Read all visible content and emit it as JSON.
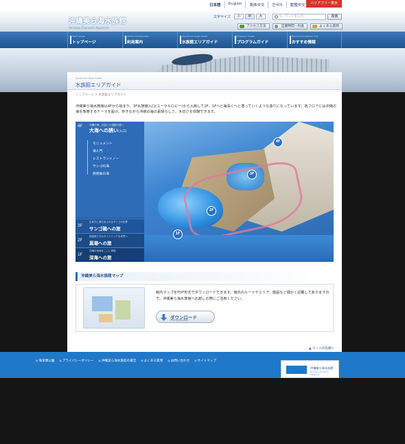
{
  "header": {
    "logo_jp": "沖縄美ら海水族館",
    "logo_en": "Okinawa Churaumi Aquarium",
    "languages": [
      "日本語",
      "English",
      "简体中文",
      "한국어",
      "繁體中文"
    ],
    "barrier_free": "バリアフリー表示",
    "font_size_label": "文字サイズ",
    "font_sizes": [
      "小",
      "中",
      "大"
    ],
    "search_placeholder": "キーワードを入力",
    "search_button": "検索",
    "quick_links": [
      "アクセス方法",
      "営業時間・料金",
      "よくある質問"
    ]
  },
  "nav": {
    "items": [
      {
        "en": "Front page",
        "jp": "トップページ"
      },
      {
        "en": "Visitor Information",
        "jp": "利用案内"
      },
      {
        "en": "Aquarium Area Guide",
        "jp": "水族館エリアガイド"
      },
      {
        "en": "Program Guide",
        "jp": "プログラムガイド"
      },
      {
        "en": "Recommendation info",
        "jp": "おすすめ情報"
      }
    ]
  },
  "page": {
    "title_en": "Aquarium Area Guide",
    "title_jp": "水族館エリアガイド",
    "breadcrumb": "トップページ > 水族館エリアガイド",
    "intro": "沖縄美ら海水族館は4Fから始まり、3F水族館入口(ユーラルロビー)から入館して2F、1Fへと海深くへと潜っていくような造りになっています。各フロアには沖縄の海を象徴するテーマを設け、歩きながら沖縄の海の素晴らしさ、大切さを体験できます。"
  },
  "area_map": {
    "floor4": {
      "tag": "4F",
      "sub": "沖縄の海、出会いと感動の旅へ",
      "title": "大海への誘い",
      "title_note": "(入口)",
      "items": [
        "モニュメント",
        "海人門",
        "レストランイノー",
        "サンゴの海",
        "熱帯魚の海"
      ]
    },
    "floors": [
      {
        "tag": "3F",
        "sub": "生命力に満ちあふれるサンゴの世界",
        "title": "サンゴ礁への旅"
      },
      {
        "tag": "2F",
        "sub": "回遊魚たちのダイナミックな世界へ",
        "title": "黒潮への旅"
      },
      {
        "tag": "1F",
        "sub": "沖縄の深海をここに再現",
        "title": "深海への旅"
      }
    ],
    "pins": [
      "4F",
      "3F",
      "2F",
      "1F"
    ]
  },
  "download": {
    "section_title": "沖縄美ら海水族館マップ",
    "text": "館内マップをPDF形式でダウンロードできます。館内のルートやエリア、施設など細かく記載してありますので、沖縄美ら海水族館へお越しの際にご活用ください。",
    "button_label": "ダウンロード",
    "button_sub": "(PDF/約500KB)"
  },
  "page_top": "ページの先頭へ",
  "footer": {
    "links": [
      "海洋博公園",
      "プライバシーポリシー",
      "沖縄美ら海水族館の運営",
      "よくある質問",
      "お問い合わせ",
      "サイトマップ"
    ],
    "logo_jp": "沖縄美ら海水族館",
    "logo_en": "Okinawa Churaumi Aquarium"
  },
  "colors": {
    "brand_blue": "#1f78c8",
    "nav_blue": "#1c548f",
    "barrier_red": "#d9342b",
    "map_panel": "#2e6cb8"
  }
}
